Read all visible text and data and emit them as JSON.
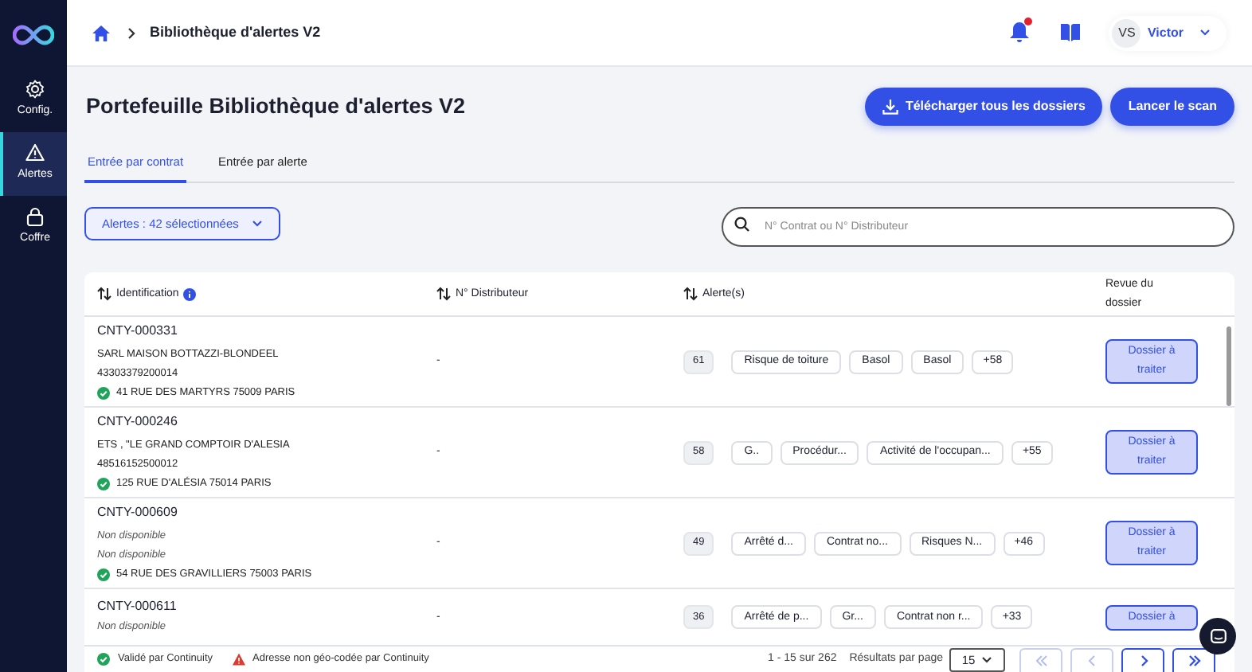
{
  "sidebar": {
    "items": [
      {
        "kind": "gear",
        "label": "Config.",
        "selected": false
      },
      {
        "kind": "warning",
        "label": "Alertes",
        "selected": true
      },
      {
        "kind": "lock",
        "label": "Coffre",
        "selected": false
      }
    ]
  },
  "breadcrumb": {
    "current": "Bibliothèque d'alertes V2"
  },
  "header": {
    "notification_unread": true,
    "user": {
      "initials": "VS",
      "name": "Victor"
    }
  },
  "page": {
    "title": "Portefeuille Bibliothèque d'alertes V2",
    "buttons": [
      {
        "kind": "download",
        "label": "Télécharger tous les dossiers"
      },
      {
        "kind": "plain",
        "label": "Lancer le scan"
      }
    ]
  },
  "tabs": [
    {
      "label": "Entrée par contrat",
      "selected": true
    },
    {
      "label": "Entrée par alerte",
      "selected": false
    }
  ],
  "filter": {
    "label": "Alertes : 42 sélectionnées"
  },
  "search": {
    "placeholder": "N° Contrat ou N° Distributeur"
  },
  "table": {
    "columns": [
      {
        "label": "Identification",
        "sortable": true,
        "info": true
      },
      {
        "label": "N° Distributeur",
        "sortable": true,
        "info": false
      },
      {
        "label": "Alerte(s)",
        "sortable": true,
        "info": false
      },
      {
        "label": "Revue du dossier",
        "sortable": false,
        "info": false
      }
    ],
    "rows": [
      {
        "id": "CNTY-000331",
        "lines": [
          {
            "text": "SARL MAISON BOTTAZZI-BLONDEEL",
            "unavailable": false
          },
          {
            "text": "43303379200014",
            "unavailable": false
          }
        ],
        "address": {
          "text": "41 RUE DES MARTYRS 75009 PARIS",
          "kind": "validated"
        },
        "distributor": "-",
        "count": "61",
        "tags": [
          "Risque de toiture",
          "Basol",
          "Basol"
        ],
        "more": "+58",
        "review": "Dossier à traiter"
      },
      {
        "id": "CNTY-000246",
        "lines": [
          {
            "text": "ETS , \"LE GRAND COMPTOIR D'ALESIA",
            "unavailable": false
          },
          {
            "text": "48516152500012",
            "unavailable": false
          }
        ],
        "address": {
          "text": "125 RUE D'ALÉSIA 75014 PARIS",
          "kind": "validated"
        },
        "distributor": "-",
        "count": "58",
        "tags": [
          "G..",
          "Procédur...",
          "Activité de l'occupan..."
        ],
        "more": "+55",
        "review": "Dossier à traiter"
      },
      {
        "id": "CNTY-000609",
        "lines": [
          {
            "text": "Non disponible",
            "unavailable": true
          },
          {
            "text": "Non disponible",
            "unavailable": true
          }
        ],
        "address": {
          "text": "54 RUE DES GRAVILLIERS 75003 PARIS",
          "kind": "validated"
        },
        "distributor": "-",
        "count": "49",
        "tags": [
          "Arrêté d...",
          "Contrat no...",
          "Risques N..."
        ],
        "more": "+46",
        "review": "Dossier à traiter"
      },
      {
        "id": "CNTY-000611",
        "lines": [
          {
            "text": "Non disponible",
            "unavailable": true
          }
        ],
        "distributor": "-",
        "count": "36",
        "tags": [
          "Arrêté de p...",
          "Gr...",
          "Contrat non r..."
        ],
        "more": "+33",
        "review": "Dossier à"
      }
    ]
  },
  "legend": [
    {
      "kind": "validated",
      "label": "Validé par Continuity"
    },
    {
      "kind": "not-geocoded",
      "label": "Adresse non géo-codée par Continuity"
    }
  ],
  "pagination": {
    "range": "1 - 15 sur 262",
    "per_page_label": "Résultats par page",
    "per_page": "15",
    "buttons": [
      {
        "kind": "first",
        "disabled": true
      },
      {
        "kind": "prev",
        "disabled": true
      },
      {
        "kind": "next",
        "disabled": false
      },
      {
        "kind": "last",
        "disabled": false
      }
    ]
  }
}
